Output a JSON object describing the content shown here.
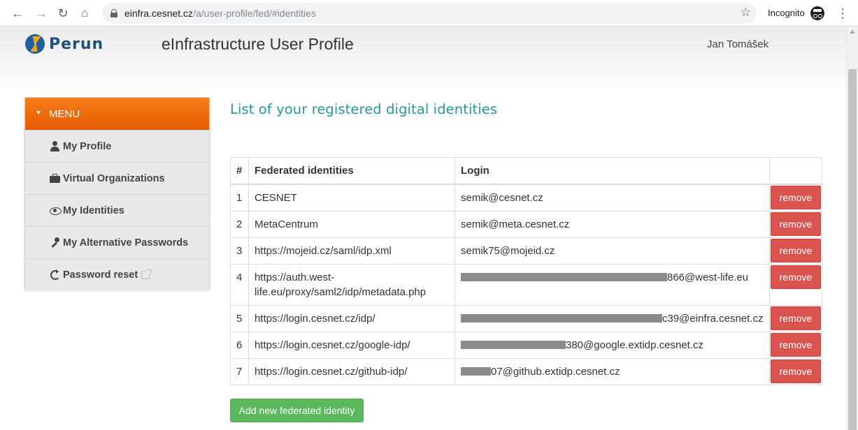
{
  "browser": {
    "url_host": "einfra.cesnet.cz",
    "url_path": "/a/user-profile/fed/#identities",
    "incognito_label": "Incognito",
    "icons": [
      "back-arrow-icon",
      "forward-arrow-icon",
      "reload-icon",
      "home-icon",
      "lock-icon",
      "star-icon",
      "incognito-icon",
      "kebab-menu-icon"
    ]
  },
  "header": {
    "logo_text": "Perun",
    "app_title": "eInfrastructure User Profile",
    "user_name": "Jan Tomášek"
  },
  "sidebar": {
    "menu_label": "MENU",
    "accent_color": "#f06d10",
    "items": [
      {
        "label": "My Profile",
        "icon": "user-icon"
      },
      {
        "label": "Virtual Organizations",
        "icon": "briefcase-icon"
      },
      {
        "label": "My Identities",
        "icon": "eye-icon"
      },
      {
        "label": "My Alternative Passwords",
        "icon": "key-icon"
      },
      {
        "label": "Password reset",
        "icon": "reset-icon",
        "external": true
      }
    ]
  },
  "main": {
    "title": "List of your registered digital identities",
    "title_color": "#26989a",
    "table": {
      "headers": {
        "num": "#",
        "federated": "Federated identities",
        "login": "Login",
        "action": ""
      },
      "rows": [
        {
          "num": "1",
          "federated": "CESNET",
          "login_suffix": "semik@cesnet.cz",
          "redacted": false
        },
        {
          "num": "2",
          "federated": "MetaCentrum",
          "login_suffix": "semik@meta.cesnet.cz",
          "redacted": false
        },
        {
          "num": "3",
          "federated": "https://mojeid.cz/saml/idp.xml",
          "login_suffix": "semik75@mojeid.cz",
          "redacted": false
        },
        {
          "num": "4",
          "federated": "https://auth.west-life.eu/proxy/saml2/idp/metadata.php",
          "login_suffix": "866@west-life.eu",
          "redacted": true
        },
        {
          "num": "5",
          "federated": "https://login.cesnet.cz/idp/",
          "login_suffix": "c39@einfra.cesnet.cz",
          "redacted": true
        },
        {
          "num": "6",
          "federated": "https://login.cesnet.cz/google-idp/",
          "login_suffix": "380@google.extidp.cesnet.cz",
          "redacted": true
        },
        {
          "num": "7",
          "federated": "https://login.cesnet.cz/github-idp/",
          "login_suffix": "07@github.extidp.cesnet.cz",
          "redacted": true
        }
      ],
      "remove_label": "remove",
      "remove_color": "#d9534f"
    },
    "add_button_label": "Add new federated identity",
    "add_button_color": "#5cb85c"
  }
}
